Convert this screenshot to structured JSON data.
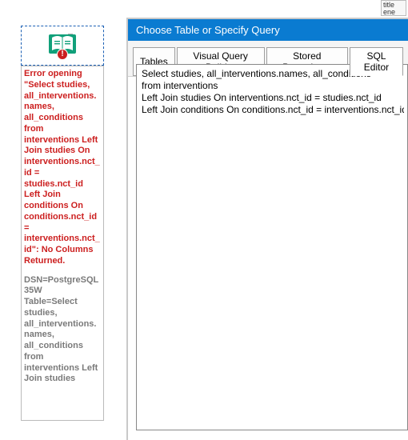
{
  "fragment": {
    "line1": "title",
    "line2": "ene"
  },
  "left_panel": {
    "error_text": "Error opening \"Select studies, all_interventions.names, all_conditions from interventions Left Join studies On interventions.nct_id = studies.nct_id Left Join conditions On conditions.nct_id = interventions.nct_id\": No Columns Returned.",
    "dsn_text": "DSN=PostgreSQL35W\nTable=Select studies, all_interventions.names, all_conditions from interventions Left Join studies"
  },
  "dialog": {
    "title": "Choose Table or Specify Query",
    "tabs": {
      "tables": "Tables",
      "visual": "Visual Query Builder",
      "stored": "Stored Procedures",
      "sql": "SQL Editor"
    },
    "sql_text": "Select studies, all_interventions.names, all_conditions\nfrom interventions\nLeft Join studies On interventions.nct_id = studies.nct_id\nLeft Join conditions On conditions.nct_id = interventions.nct_id"
  }
}
